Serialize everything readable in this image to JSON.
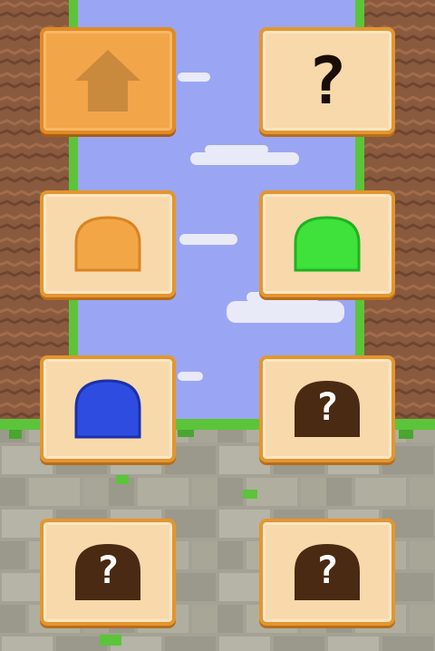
{
  "game": {
    "screen": "slime-collection",
    "colors": {
      "sky": "#9aa6f3",
      "dirt": "#8a5a3e",
      "grass": "#5cc43a",
      "stone": "#9b9a8c",
      "tile_fill": "#f7d9ab",
      "tile_border": "#e3962f",
      "home_fill": "#f2a549",
      "locked_slime": "#4a2a12"
    },
    "buttons": {
      "home_icon": "home-icon",
      "help_label": "?"
    },
    "slimes": [
      {
        "state": "unlocked",
        "color": "#f3a646",
        "label": ""
      },
      {
        "state": "unlocked",
        "color": "#3ee23a",
        "label": ""
      },
      {
        "state": "unlocked",
        "color": "#2e4de0",
        "label": ""
      },
      {
        "state": "locked",
        "color": "#4a2a12",
        "label": "?"
      },
      {
        "state": "locked",
        "color": "#4a2a12",
        "label": "?"
      },
      {
        "state": "locked",
        "color": "#4a2a12",
        "label": "?"
      }
    ]
  }
}
